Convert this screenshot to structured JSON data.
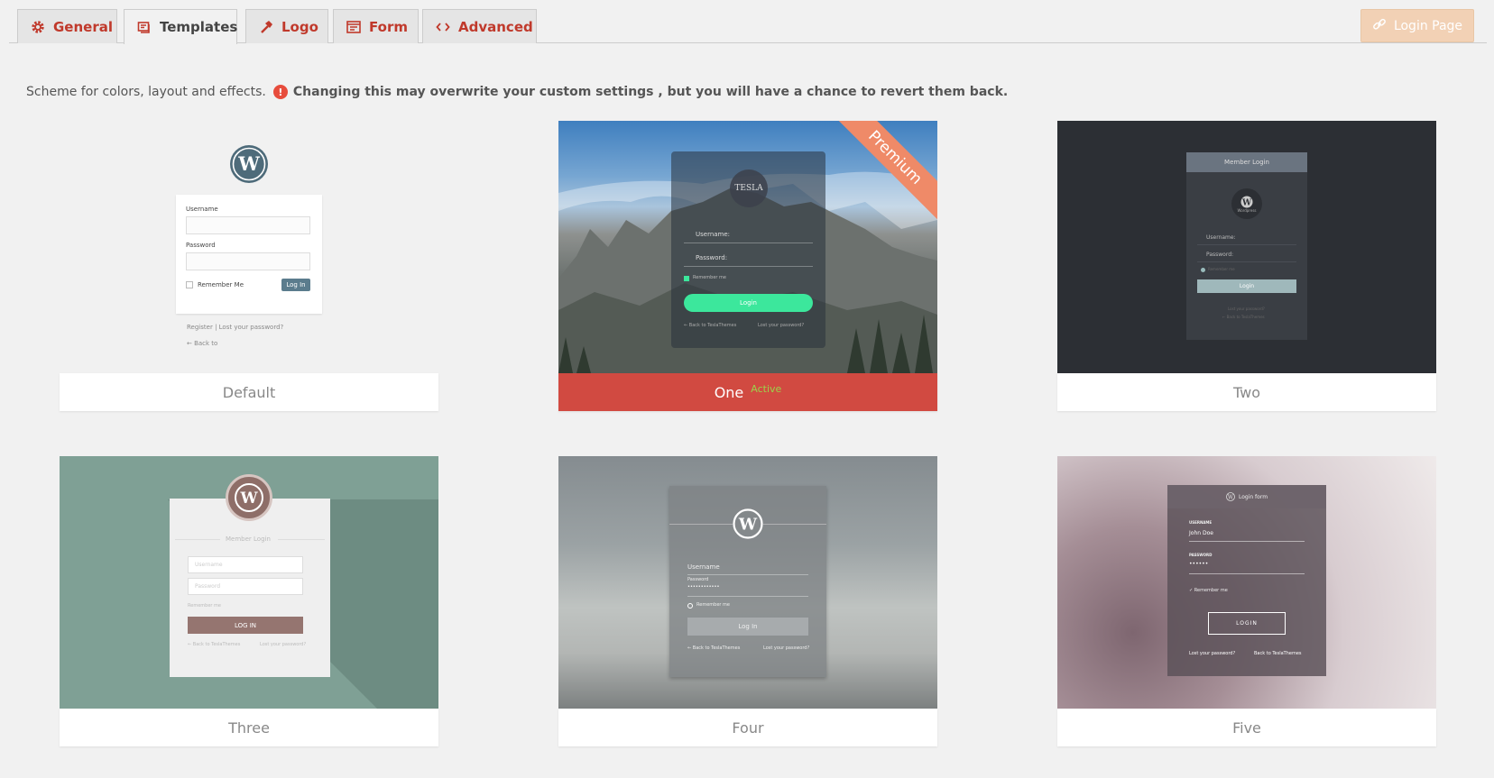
{
  "tabs": [
    {
      "label": "General",
      "icon": "gear-icon"
    },
    {
      "label": "Templates",
      "icon": "templates-icon"
    },
    {
      "label": "Logo",
      "icon": "hammer-icon"
    },
    {
      "label": "Form",
      "icon": "form-icon"
    },
    {
      "label": "Advanced",
      "icon": "code-icon"
    }
  ],
  "active_tab": "Templates",
  "login_page_button": {
    "label": "Login Page",
    "icon": "link-icon"
  },
  "notice": {
    "text": "Scheme for colors, layout and effects.",
    "warning": "Changing this may overwrite your custom settings , but you will have a chance to revert them back."
  },
  "templates": [
    {
      "name": "Default",
      "active": false,
      "preview": {
        "username": "Username",
        "password": "Password",
        "remember": "Remember Me",
        "login": "Log In",
        "register": "Register",
        "separator": "|",
        "lost": "Lost your password?",
        "back": "← Back to"
      }
    },
    {
      "name": "One",
      "active": true,
      "active_label": "Active",
      "ribbon": "Premium",
      "preview": {
        "logo": "TESLA",
        "username": "Username:",
        "password": "Password:",
        "remember": "Remember me",
        "login": "Login",
        "back": "← Back to TeslaThemes",
        "lost": "Lost your password?"
      }
    },
    {
      "name": "Two",
      "active": false,
      "preview": {
        "title": "Member Login",
        "logo_caption": "Wordpress",
        "username": "Username:",
        "password": "Password:",
        "remember": "Remember me",
        "login": "Login",
        "lost": "Lost your password?",
        "back": "← Back to TeslaThemes"
      }
    },
    {
      "name": "Three",
      "active": false,
      "preview": {
        "title": "Member Login",
        "username": "Username",
        "password": "Password",
        "remember": "Remember me",
        "login": "LOG IN",
        "back": "← Back to TeslaThemes",
        "lost": "Lost your password?"
      }
    },
    {
      "name": "Four",
      "active": false,
      "preview": {
        "username": "Username",
        "password": "Password",
        "password_mask": "••••••••••••",
        "remember": "Remember me",
        "login": "Log In",
        "back": "← Back to TeslaThemes",
        "lost": "Lost your password?"
      }
    },
    {
      "name": "Five",
      "active": false,
      "preview": {
        "title": "Login form",
        "username_label": "USERNAME",
        "username_value": "John Doe",
        "password_label": "PASSWORD",
        "password_mask": "••••••",
        "remember": "Remember me",
        "login": "LOGIN",
        "lost": "Lost your password?",
        "back": "Back to TeslaThemes"
      }
    }
  ],
  "colors": {
    "accent": "#c0392b",
    "active_card": "#d14a41",
    "active_badge": "#9bd34b",
    "ribbon": "#ef8a68",
    "login_button_bg": "#f2d1b5"
  }
}
